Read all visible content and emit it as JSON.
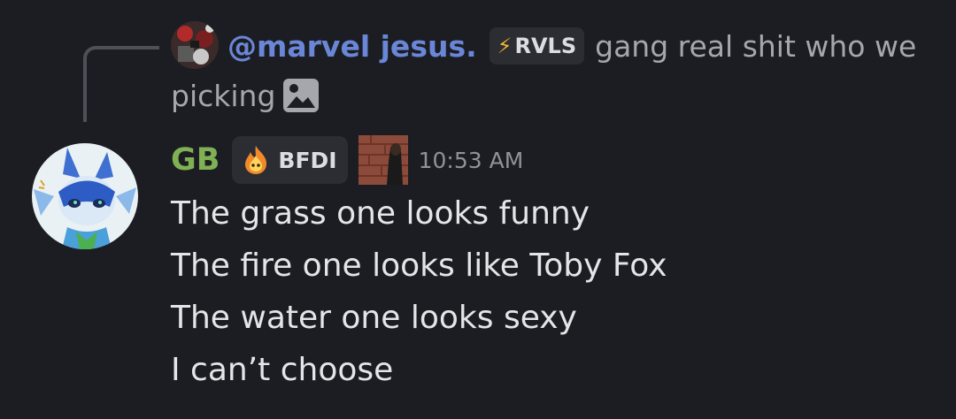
{
  "reply": {
    "mention": "@marvel jesus.",
    "tag": "RVLS",
    "tag_icon": "lightning-icon",
    "text": "gang real shit who we picking",
    "attachment_icon": "image-attachment-icon"
  },
  "message": {
    "author": "GB",
    "author_color": "#7fb054",
    "role": "BFDI",
    "role_icon": "flame-icon",
    "timestamp": "10:53 AM",
    "lines": [
      "The grass one looks funny",
      "The fire one looks like Toby Fox",
      "The water one looks sexy",
      "I can’t choose"
    ]
  }
}
